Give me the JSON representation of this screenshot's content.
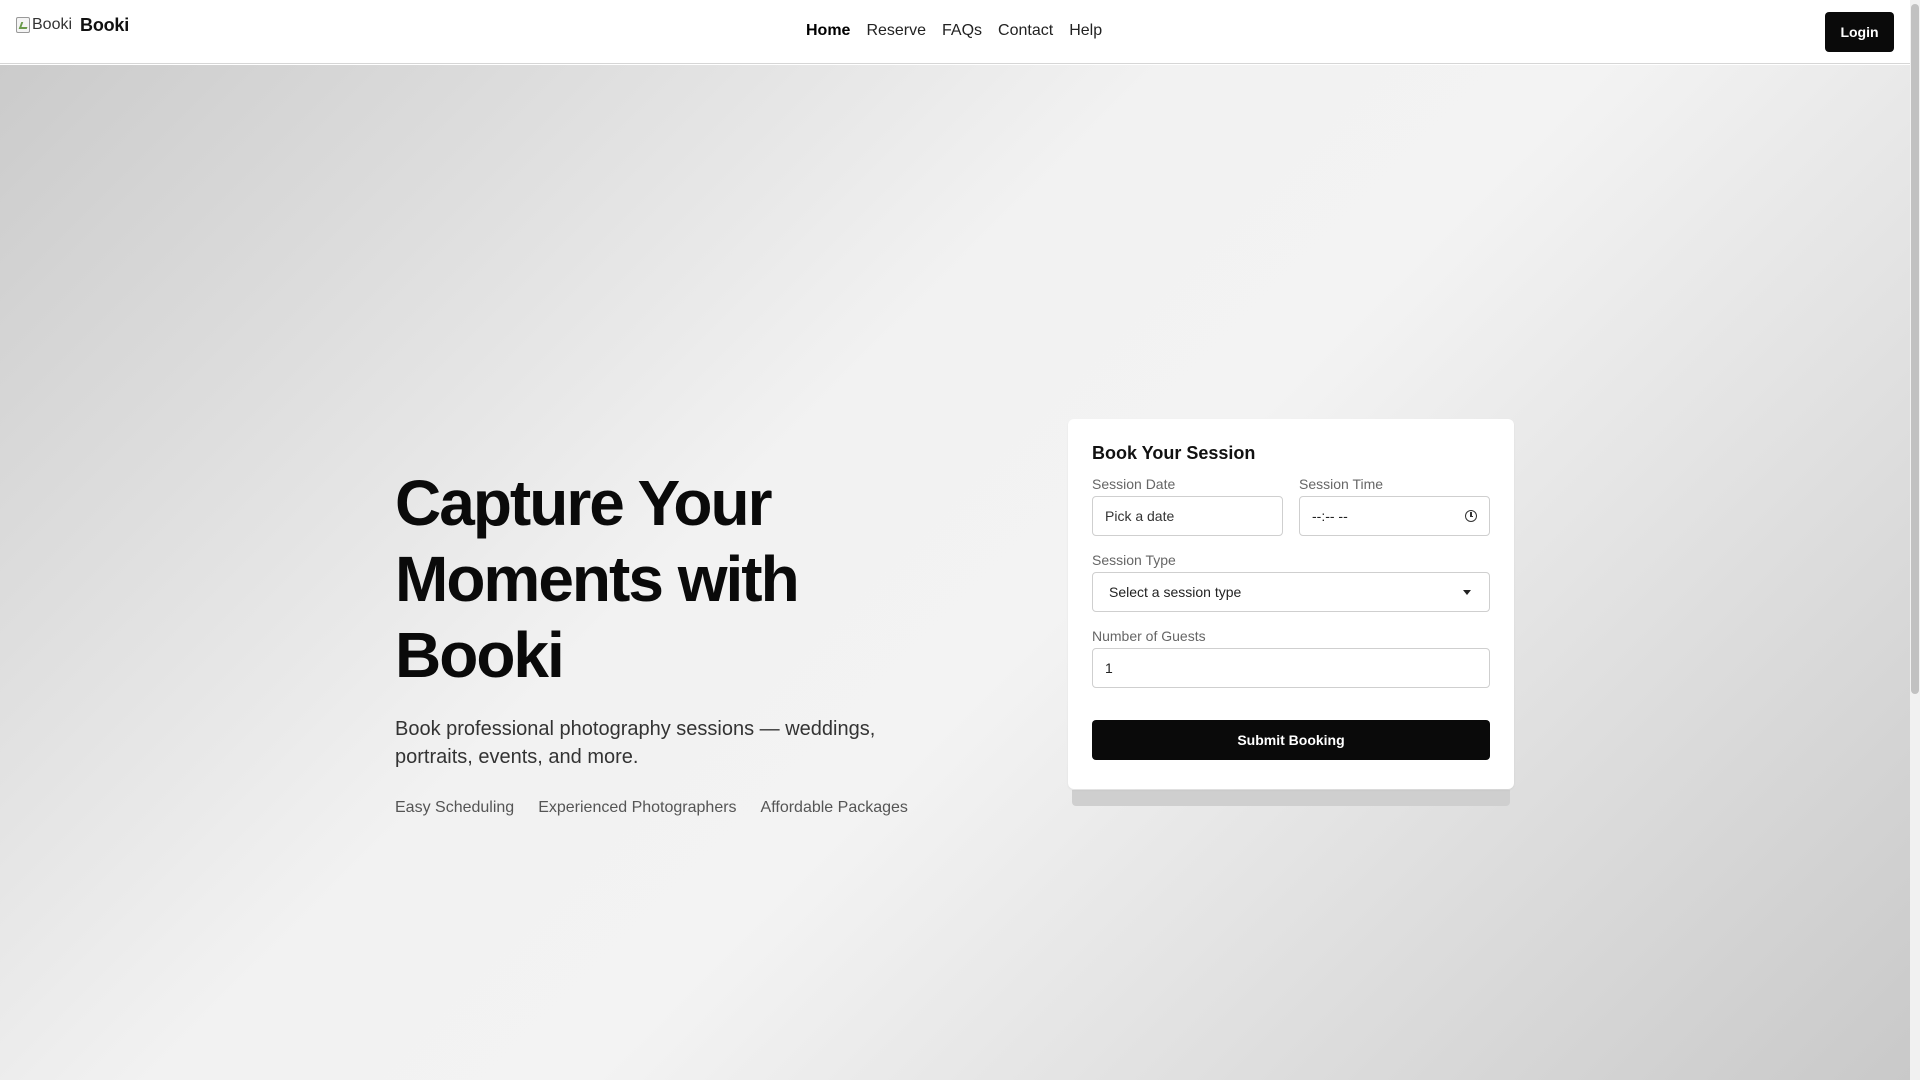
{
  "header": {
    "logo_alt": "Booki",
    "brand_name": "Booki",
    "nav": [
      {
        "label": "Home",
        "active": true
      },
      {
        "label": "Reserve",
        "active": false
      },
      {
        "label": "FAQs",
        "active": false
      },
      {
        "label": "Contact",
        "active": false
      },
      {
        "label": "Help",
        "active": false
      }
    ],
    "login_label": "Login"
  },
  "hero": {
    "title_line1": "Capture Your",
    "title_line2": "Moments with Booki",
    "subtitle": "Book professional photography sessions — weddings, portraits, events, and more.",
    "features": [
      "Easy Scheduling",
      "Experienced Photographers",
      "Affordable Packages"
    ]
  },
  "booking": {
    "title": "Book Your Session",
    "date_label": "Session Date",
    "date_placeholder": "Pick a date",
    "time_label": "Session Time",
    "time_value": "--:-- --",
    "type_label": "Session Type",
    "type_value": "Select a session type",
    "guests_label": "Number of Guests",
    "guests_value": "1",
    "submit_label": "Submit Booking"
  },
  "colors": {
    "primary": "#0a0a0a",
    "background": "#ffffff",
    "border": "#cfcfcf"
  }
}
